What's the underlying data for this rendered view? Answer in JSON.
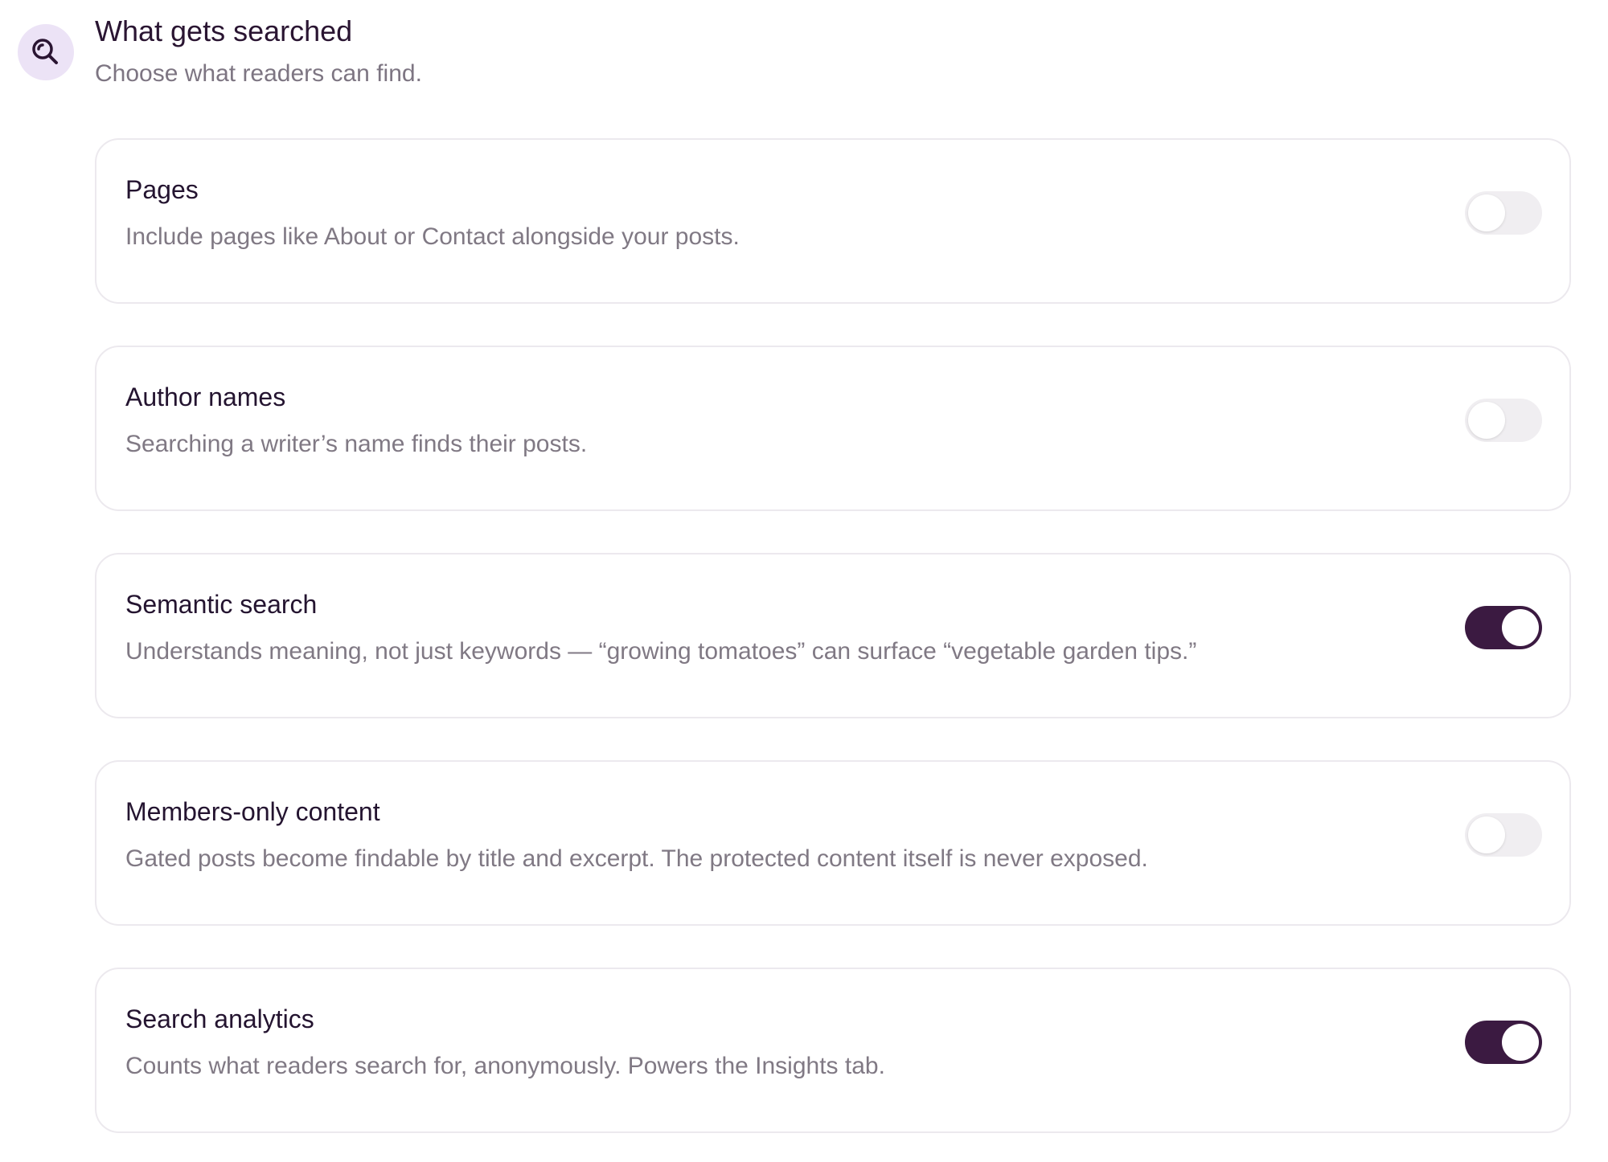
{
  "section": {
    "icon": "search-icon",
    "title": "What gets searched",
    "subtitle": "Choose what readers can find."
  },
  "options": [
    {
      "title": "Pages",
      "description": "Include pages like About or Contact alongside your posts.",
      "enabled": false
    },
    {
      "title": "Author names",
      "description": "Searching a writer’s name finds their posts.",
      "enabled": false
    },
    {
      "title": "Semantic search",
      "description": "Understands meaning, not just keywords — “growing tomatoes” can surface “vegetable garden tips.”",
      "enabled": true
    },
    {
      "title": "Members-only content",
      "description": "Gated posts become findable by title and excerpt. The protected content itself is never exposed.",
      "enabled": false
    },
    {
      "title": "Search analytics",
      "description": "Counts what readers search for, anonymously. Powers the Insights tab.",
      "enabled": true
    }
  ],
  "colors": {
    "accent": "#3b1a41",
    "icon_background": "#ece3f6",
    "toggle_off": "#f0eef1"
  }
}
